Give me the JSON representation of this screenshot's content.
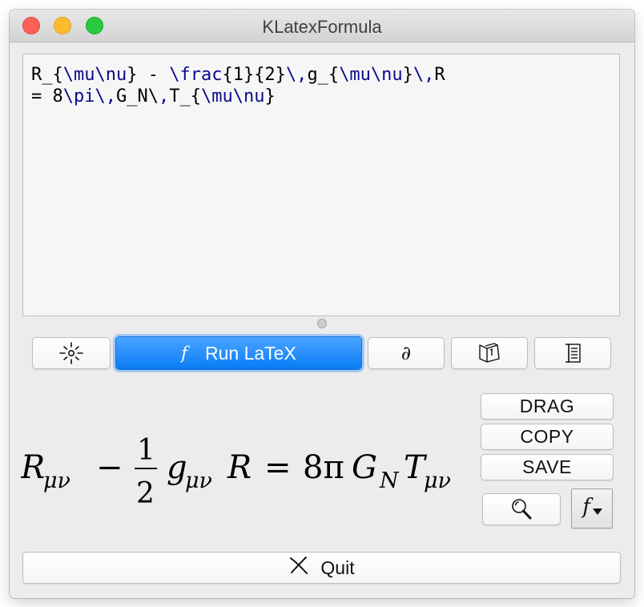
{
  "window": {
    "title": "KLatexFormula"
  },
  "editor": {
    "line1": [
      {
        "t": "R_{",
        "k": false
      },
      {
        "t": "\\mu\\nu",
        "k": true
      },
      {
        "t": "} - ",
        "k": false
      },
      {
        "t": "\\frac",
        "k": true
      },
      {
        "t": "{1}{2}",
        "k": false
      },
      {
        "t": "\\,",
        "k": true
      },
      {
        "t": "g_{",
        "k": false
      },
      {
        "t": "\\mu\\nu",
        "k": true
      },
      {
        "t": "}",
        "k": false
      },
      {
        "t": "\\,",
        "k": true
      },
      {
        "t": "R",
        "k": false
      }
    ],
    "line2": [
      {
        "t": "= 8",
        "k": false
      },
      {
        "t": "\\pi\\,",
        "k": true
      },
      {
        "t": "G_N\\",
        "k": false
      },
      {
        "t": ",",
        "k": true
      },
      {
        "t": "T_{",
        "k": false
      },
      {
        "t": "\\mu\\nu",
        "k": true
      },
      {
        "t": "}",
        "k": false
      }
    ]
  },
  "toolbar": {
    "run_icon": "f",
    "run_label": "Run LaTeX",
    "partial_symbol": "∂",
    "icons": [
      "sparkle-icon",
      "book-icon",
      "settings-list-icon"
    ]
  },
  "preview": {
    "formula": {
      "R": "R",
      "mu_nu": "μν",
      "minus": "−",
      "one": "1",
      "two": "2",
      "g": "g",
      "R2": "R",
      "equals": "=",
      "eight_pi": "8π",
      "G": "G",
      "N": "N",
      "T": "T"
    }
  },
  "actions": {
    "drag": "DRAG",
    "copy": "COPY",
    "save": "SAVE",
    "magnifier_icon": "magnifier-icon",
    "style_glyph": "f"
  },
  "quit": {
    "label": "Quit"
  },
  "colors": {
    "keyword": "#0a0a8c",
    "accent": "#0a7bf6"
  }
}
